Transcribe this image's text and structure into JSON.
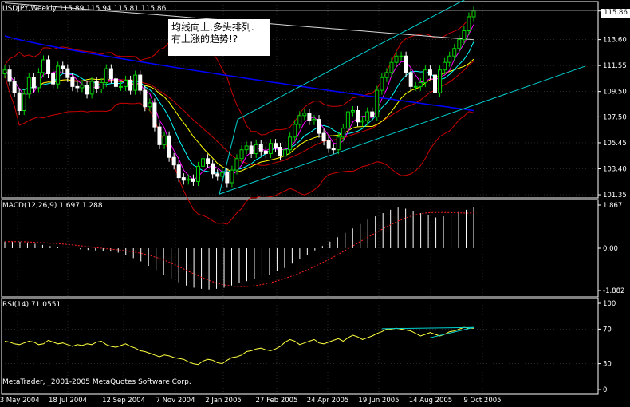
{
  "header": {
    "price_pane_title": "USDJPY,Weekly  115.89 115.94 115.81 115.86",
    "macd_title": "MACD(12,26,9) 1.697 1.288",
    "rsi_title": "RSI(14) 71.0551",
    "copyright": "MetaTrader, _2001-2005 MetaQuotes Software Corp.",
    "annotation": "均线向上,多头排列.\n有上涨的趋势!?",
    "current_price": "115.86"
  },
  "colors": {
    "background": "#000000",
    "grid": "#505050",
    "bull": "#00d200",
    "bear": "#ffffff",
    "ma_fast": "#ff00ff",
    "ma_mid": "#00ffff",
    "ma_slow": "#ffff00",
    "ma_200": "#0000ff",
    "bollinger": "#cc0000",
    "trendline": "#00d0d0",
    "signal": "#ff2020",
    "rsi": "#ffff40"
  },
  "chart_data": [
    {
      "type": "candlestick",
      "title": "USDJPY,Weekly",
      "ohlc": [
        115.89,
        115.94,
        115.81,
        115.86
      ],
      "y_ticks": [
        "115.86",
        "113.60",
        "111.55",
        "109.50",
        "107.50",
        "105.45",
        "103.40",
        "101.35"
      ],
      "ylim": [
        101.1,
        116.6
      ],
      "x_ticks": [
        "23 May 2004",
        "18 Jul 2004",
        "12 Sep 2004",
        "7 Nov 2004",
        "2 Jan 2005",
        "27 Feb 2005",
        "24 Apr 2005",
        "19 Jun 2005",
        "14 Aug 2005",
        "9 Oct 2005"
      ],
      "closes": [
        111.2,
        110.3,
        109.4,
        108.0,
        109.3,
        110.6,
        109.8,
        111.0,
        112.0,
        110.9,
        110.1,
        111.5,
        111.3,
        110.6,
        109.9,
        109.8,
        110.0,
        109.3,
        110.3,
        109.7,
        110.2,
        111.3,
        110.5,
        109.9,
        109.9,
        110.4,
        109.6,
        110.8,
        109.6,
        108.3,
        108.6,
        106.7,
        105.3,
        106.0,
        104.3,
        103.7,
        102.7,
        102.5,
        102.6,
        102.4,
        103.6,
        104.2,
        103.8,
        103.0,
        102.8,
        103.1,
        102.3,
        103.3,
        104.2,
        104.9,
        105.2,
        104.6,
        105.3,
        104.8,
        104.6,
        105.4,
        105.1,
        104.4,
        104.9,
        105.9,
        106.9,
        107.6,
        107.8,
        107.2,
        107.3,
        106.2,
        105.6,
        105.0,
        104.9,
        105.9,
        106.6,
        107.9,
        108.0,
        107.1,
        107.2,
        107.9,
        107.5,
        109.6,
        110.6,
        111.0,
        111.8,
        112.3,
        112.3,
        111.0,
        109.9,
        109.9,
        110.2,
        111.2,
        110.8,
        109.4,
        111.2,
        111.8,
        112.3,
        112.9,
        113.6,
        114.3,
        115.4,
        115.86
      ],
      "ma_fast_last": [
        112.0,
        112.7,
        113.3,
        113.9,
        114.3
      ],
      "ma_200_start": 113.9,
      "ma_200_end": 108.0,
      "channel_upper": {
        "from": [
          "2 Jan 2005",
          107.3
        ],
        "to": [
          "9 Oct 2005",
          117.0
        ]
      },
      "channel_lower": {
        "from": [
          "2 Jan 2005",
          101.4
        ],
        "to": [
          "9 Oct 2005",
          108.4
        ]
      }
    },
    {
      "type": "bar",
      "title": "MACD(12,26,9)",
      "macd_value": 1.697,
      "signal_value": 1.288,
      "y_ticks": [
        "1.867",
        "0.00",
        "-1.882"
      ],
      "ylim": [
        -2.0,
        2.0
      ],
      "histogram": [
        0.3,
        0.3,
        0.3,
        0.25,
        0.2,
        0.15,
        0.1,
        0.05,
        0.0,
        0.0,
        -0.05,
        -0.08,
        -0.1,
        -0.12,
        -0.15,
        -0.2,
        -0.3,
        -0.45,
        -0.6,
        -0.8,
        -1.0,
        -1.2,
        -1.4,
        -1.55,
        -1.7,
        -1.8,
        -1.85,
        -1.88,
        -1.85,
        -1.8,
        -1.7,
        -1.6,
        -1.5,
        -1.4,
        -1.3,
        -1.2,
        -1.05,
        -0.9,
        -0.7,
        -0.5,
        -0.3,
        -0.1,
        0.1,
        0.3,
        0.5,
        0.7,
        0.9,
        1.1,
        1.3,
        1.45,
        1.6,
        1.75,
        1.85,
        1.8,
        1.7,
        1.6,
        1.5,
        1.4,
        1.45,
        1.55,
        1.65,
        1.75,
        1.867
      ]
    },
    {
      "type": "line",
      "title": "RSI(14)",
      "last_value": 71.0551,
      "y_ticks": [
        "100",
        "70",
        "30",
        "0"
      ],
      "ylim": [
        0,
        100
      ],
      "values": [
        56,
        55,
        53,
        52,
        54,
        56,
        55,
        52,
        53,
        57,
        55,
        53,
        54,
        52,
        50,
        52,
        51,
        53,
        52,
        55,
        56,
        52,
        50,
        49,
        51,
        53,
        50,
        48,
        45,
        44,
        42,
        40,
        38,
        40,
        39,
        37,
        36,
        35,
        32,
        30,
        29,
        33,
        35,
        34,
        31,
        30,
        34,
        37,
        38,
        40,
        44,
        45,
        47,
        48,
        46,
        45,
        47,
        50,
        55,
        58,
        56,
        52,
        54,
        56,
        58,
        54,
        53,
        55,
        57,
        59,
        56,
        60,
        63,
        61,
        58,
        60,
        62,
        65,
        67,
        70,
        70,
        71,
        70,
        69,
        68,
        65,
        62,
        64,
        66,
        64,
        62,
        64,
        67,
        68,
        70,
        72,
        71,
        71.06
      ]
    }
  ]
}
